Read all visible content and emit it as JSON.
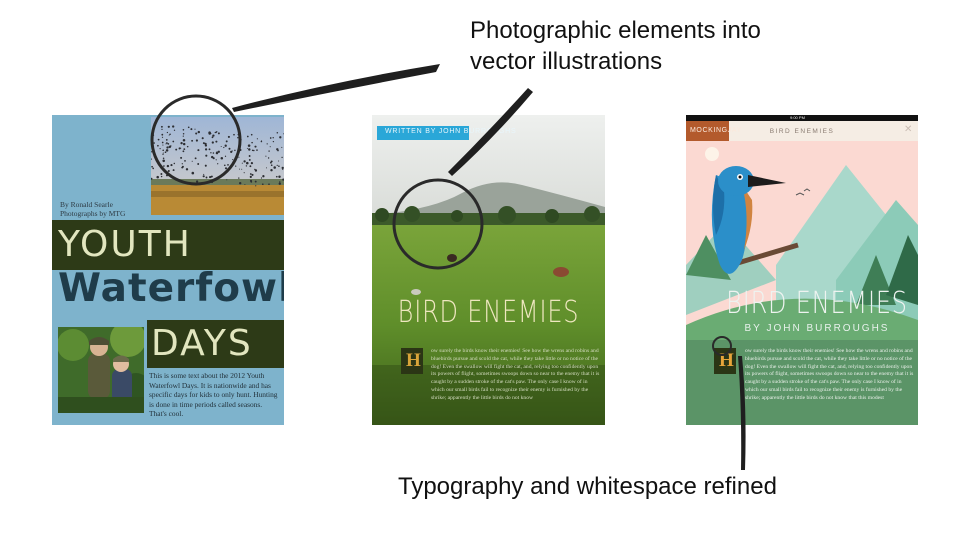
{
  "annotations": {
    "top_line1": "Photographic elements into",
    "top_line2": "vector illustrations",
    "bottom": "Typography and whitespace refined"
  },
  "cover1": {
    "credit_line1": "By Ronald Searle",
    "credit_line2": "Photographs by MTG",
    "title_word1": "YOUTH",
    "title_word2": "Waterfowl",
    "title_word3": "DAYS",
    "body": "This is some text about the 2012 Youth Waterfowl Days. It is nationwide and has specific days for kids to only hunt. Hunting is done in time periods called seasons. That's cool."
  },
  "cover2": {
    "ribbon": "WRITTEN BY JOHN BURROUGHS",
    "title": "BIRD ENEMIES",
    "dropcap": "H",
    "body": "ow surely the birds know their enemies! See how the wrens and robins and bluebirds pursue and scold the cat, while they take little or no notice of the dog! Even the swallow will fight the cat, and, relying too confidently upon its powers of flight, sometimes swoops down so near to the enemy that it is caught by a sudden stroke of the cat's paw. The only case I know of in which our small birds fail to recognize their enemy is furnished by the shrike; apparently the little birds do not know"
  },
  "cover3": {
    "status_time": "9:00 PM",
    "badge": "MOCKINGJAY",
    "bar_title": "BIRD ENEMIES",
    "title": "BIRD ENEMIES",
    "author": "BY JOHN BURROUGHS",
    "dropcap": "H",
    "body": "ow surely the birds know their enemies! See how the wrens and robins and bluebirds pursue and scold the cat, while they take little or no notice of the dog! Even the swallow will fight the cat, and, relying too confidently upon its powers of flight, sometimes swoops down so near to the enemy that it is caught by a sudden stroke of the cat's paw. The only case I know of in which our small birds fail to recognize their enemy is furnished by the shrike; apparently the little birds do not know that this modest"
  },
  "colors": {
    "cover1_bg": "#7eb3cc",
    "cover1_band": "#2d3a17",
    "cover2_ribbon": "#2aa7d8",
    "cover3_badge": "#b35a2c",
    "kingfisher_blue": "#2b8fc9"
  }
}
